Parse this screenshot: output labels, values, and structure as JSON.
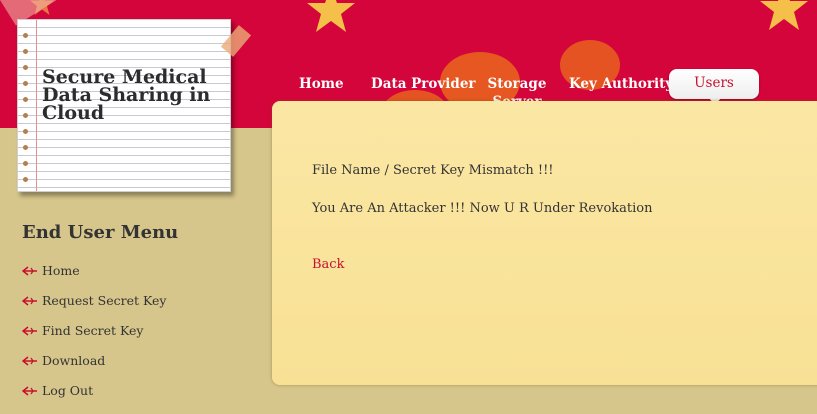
{
  "site": {
    "title": "Secure Medical Data Sharing in Cloud"
  },
  "nav": {
    "items": [
      {
        "label": "Home"
      },
      {
        "label": "Data Provider"
      },
      {
        "label": "Storage Server"
      },
      {
        "label": "Key Authority"
      },
      {
        "label": "Users"
      }
    ],
    "active": "Users"
  },
  "content": {
    "message_1": "File Name / Secret Key Mismatch !!!",
    "message_2": "You Are An Attacker !!! Now U R Under Revokation",
    "back_label": "Back"
  },
  "sidebar": {
    "title": "End User Menu",
    "items": [
      {
        "label": "Home",
        "icon": "arrow-icon"
      },
      {
        "label": "Request Secret Key",
        "icon": "arrow-icon"
      },
      {
        "label": "Find Secret Key",
        "icon": "arrow-icon"
      },
      {
        "label": "Download",
        "icon": "arrow-icon"
      },
      {
        "label": "Log Out",
        "icon": "arrow-icon"
      }
    ]
  },
  "colors": {
    "header_red": "#d4053a",
    "body_tan": "#d6c68c",
    "panel_yellow": "#f9e294",
    "link_red": "#c8102e",
    "star_gold": "#f5c04a"
  }
}
